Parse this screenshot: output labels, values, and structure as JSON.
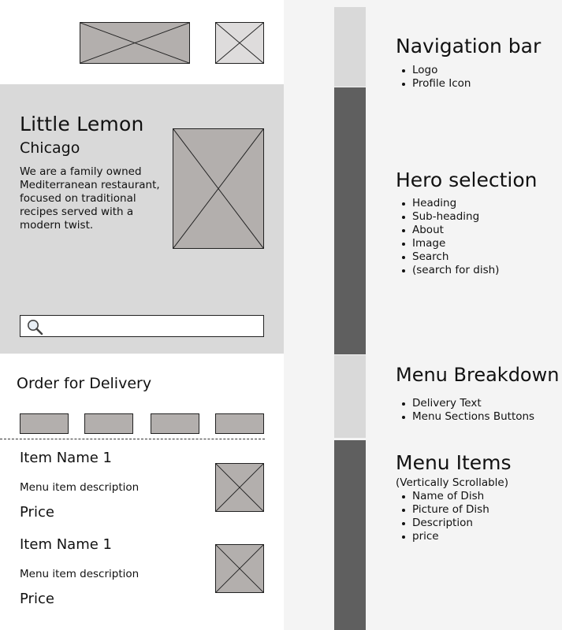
{
  "wireframe": {
    "hero": {
      "title": "Little Lemon",
      "subtitle": "Chicago",
      "description": "We are a family owned Mediterranean restaurant, focused on traditional recipes served with a modern twist.",
      "search_icon": "search-icon"
    },
    "delivery": {
      "label": "Order for Delivery",
      "section_button_count": 4
    },
    "items": [
      {
        "name": "Item Name 1",
        "description": "Menu item description",
        "price": "Price"
      },
      {
        "name": "Item Name 1",
        "description": "Menu item description",
        "price": "Price"
      }
    ]
  },
  "annotations": {
    "nav": {
      "heading": "Navigation bar",
      "bullets": [
        "Logo",
        "Profile Icon"
      ]
    },
    "hero": {
      "heading": "Hero selection",
      "bullets": [
        "Heading",
        "Sub-heading",
        "About",
        "Image",
        "Search",
        "(search for dish)"
      ]
    },
    "breakdown": {
      "heading": "Menu Breakdown",
      "bullets": [
        "Delivery Text",
        "Menu Sections Buttons"
      ]
    },
    "items": {
      "heading": "Menu Items",
      "note": "(Vertically Scrollable)",
      "bullets": [
        "Name of Dish",
        "Picture of Dish",
        "Description",
        "price"
      ]
    }
  },
  "colors": {
    "placeholder_dark": "#b3afad",
    "placeholder_light": "#dedcdc",
    "section_light": "#d9d9d9",
    "section_dark": "#5f5f5f",
    "canvas": "#f4f4f4"
  }
}
